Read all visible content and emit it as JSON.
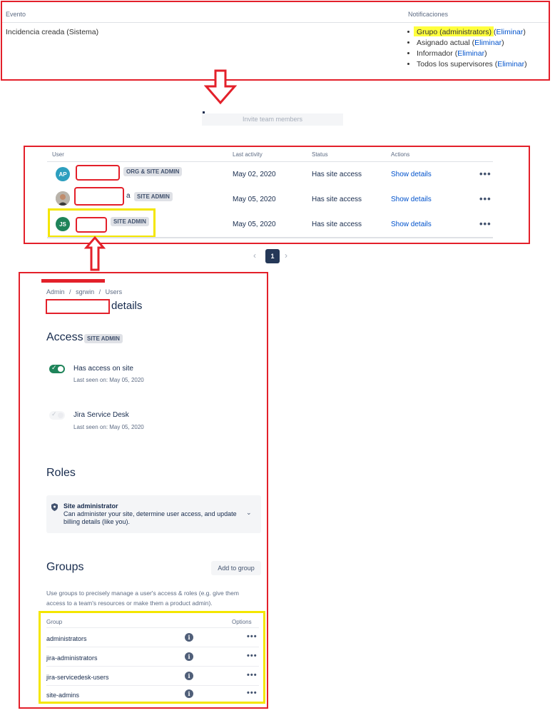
{
  "notifications": {
    "col_event": "Evento",
    "col_notifications": "Notificaciones",
    "event_name": "Incidencia creada (Sistema)",
    "items": [
      {
        "text": "Grupo (administrators) (",
        "action": "Eliminar",
        "close": ")"
      },
      {
        "text": "Asignado actual (",
        "action": "Eliminar",
        "close": ")"
      },
      {
        "text": "Informador (",
        "action": "Eliminar",
        "close": ")"
      },
      {
        "text": "Todos los supervisores (",
        "action": "Eliminar",
        "close": ")"
      }
    ]
  },
  "invite": {
    "label": "Invite team members"
  },
  "users_table": {
    "headers": {
      "user": "User",
      "last_activity": "Last activity",
      "status": "Status",
      "actions": "Actions"
    },
    "rows": [
      {
        "initials": "AP",
        "avatar_color": "#2d9fbf",
        "badge": "ORG & SITE ADMIN",
        "last_activity": "May 02, 2020",
        "status": "Has site access",
        "action": "Show details",
        "extra": ""
      },
      {
        "initials": "",
        "avatar_color": "#6b6b6b",
        "badge": "SITE ADMIN",
        "last_activity": "May 05, 2020",
        "status": "Has site access",
        "action": "Show details",
        "extra": "a"
      },
      {
        "initials": "JS",
        "avatar_color": "#1f845a",
        "badge": "SITE ADMIN",
        "last_activity": "May 05, 2020",
        "status": "Has site access",
        "action": "Show details",
        "extra": ""
      }
    ],
    "more_icon": "•••"
  },
  "pagination": {
    "current": "1",
    "prev_icon": "chevron-left-icon",
    "next_icon": "chevron-right-icon"
  },
  "details": {
    "breadcrumb": {
      "admin": "Admin",
      "site": "sgrwin",
      "users": "Users",
      "sep": "/"
    },
    "title_suffix": "details",
    "access": {
      "heading": "Access",
      "badge": "SITE ADMIN",
      "products": [
        {
          "name": "Has access on site",
          "last_seen": "Last seen on: May 05, 2020",
          "enabled": true
        },
        {
          "name": "Jira Service Desk",
          "last_seen": "Last seen on: May 05, 2020",
          "enabled": false
        }
      ]
    },
    "roles": {
      "heading": "Roles",
      "role_name": "Site administrator",
      "role_desc_1": "Can administer your site, determine user access, and update",
      "role_desc_2": "billing details (like you)."
    },
    "groups": {
      "heading": "Groups",
      "add_button": "Add to group",
      "desc_1": "Use groups to precisely manage a user's access & roles (e.g. give them",
      "desc_2": "access to a team's resources or make them a product admin).",
      "col_group": "Group",
      "col_options": "Options",
      "items": [
        {
          "name": "administrators"
        },
        {
          "name": "jira-administrators"
        },
        {
          "name": "jira-servicedesk-users"
        },
        {
          "name": "site-admins"
        }
      ],
      "more_icon": "•••",
      "info_icon": "i"
    }
  },
  "colors": {
    "annotation_red": "#e3202a",
    "annotation_yellow": "#f4e600",
    "highlight": "#ffff3d",
    "link": "#0052cc",
    "toggle_on": "#1f845a"
  }
}
